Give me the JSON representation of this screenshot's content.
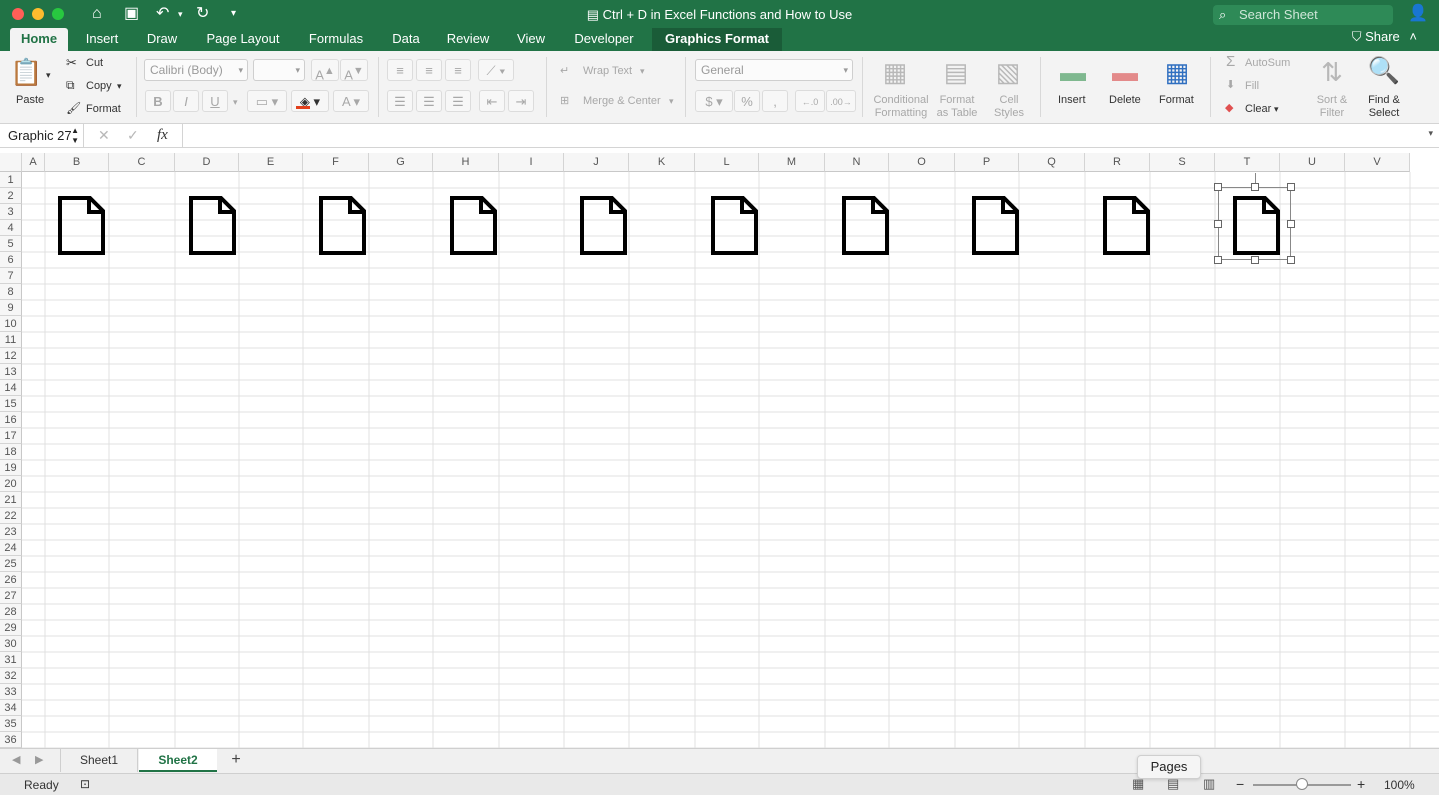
{
  "window": {
    "title": "Ctrl + D in Excel Functions and How to Use",
    "search_placeholder": "Search Sheet"
  },
  "tabs": [
    {
      "label": "Home"
    },
    {
      "label": "Insert"
    },
    {
      "label": "Draw"
    },
    {
      "label": "Page Layout"
    },
    {
      "label": "Formulas"
    },
    {
      "label": "Data"
    },
    {
      "label": "Review"
    },
    {
      "label": "View"
    },
    {
      "label": "Developer"
    },
    {
      "label": "Graphics Format"
    }
  ],
  "share_label": "Share",
  "ribbon": {
    "paste": "Paste",
    "cut": "Cut",
    "copy": "Copy",
    "format_painter": "Format",
    "font_name": "Calibri (Body)",
    "bold": "B",
    "italic": "I",
    "underline": "U",
    "wrap_text": "Wrap Text",
    "merge_center": "Merge & Center",
    "number_format": "General",
    "currency": "$",
    "percent": "%",
    "conditional_formatting": [
      "Conditional",
      "Formatting"
    ],
    "format_as_table": [
      "Format",
      "as Table"
    ],
    "cell_styles": [
      "Cell",
      "Styles"
    ],
    "insert": "Insert",
    "delete": "Delete",
    "format": "Format",
    "autosum": "AutoSum",
    "fill": "Fill",
    "clear": "Clear",
    "sort_filter": [
      "Sort &",
      "Filter"
    ],
    "find_select": [
      "Find &",
      "Select"
    ]
  },
  "formula_bar": {
    "name_box": "Graphic 27",
    "fx": "fx",
    "value": ""
  },
  "columns": [
    "A",
    "B",
    "C",
    "D",
    "E",
    "F",
    "G",
    "H",
    "I",
    "J",
    "K",
    "L",
    "M",
    "N",
    "O",
    "P",
    "Q",
    "R",
    "S",
    "T",
    "U",
    "V"
  ],
  "rows": [
    "1",
    "2",
    "3",
    "4",
    "5",
    "6",
    "7",
    "8",
    "9",
    "10",
    "11",
    "12",
    "13",
    "14",
    "15",
    "16",
    "17",
    "18",
    "19",
    "20",
    "21",
    "22",
    "23",
    "24",
    "25",
    "26",
    "27",
    "28",
    "29",
    "30",
    "31",
    "32",
    "33",
    "34",
    "35",
    "36"
  ],
  "graphics": {
    "icon": "document-icon",
    "count": 10,
    "selected": "Graphic 27"
  },
  "sheets": [
    {
      "label": "Sheet1",
      "active": false
    },
    {
      "label": "Sheet2",
      "active": true
    }
  ],
  "add_sheet": "+",
  "status": {
    "ready": "Ready",
    "zoom": "100%",
    "tooltip": "Pages",
    "zoom_minus": "−",
    "zoom_plus": "+"
  },
  "colors": {
    "accent": "#217346",
    "tab_active_text": "#217346"
  }
}
